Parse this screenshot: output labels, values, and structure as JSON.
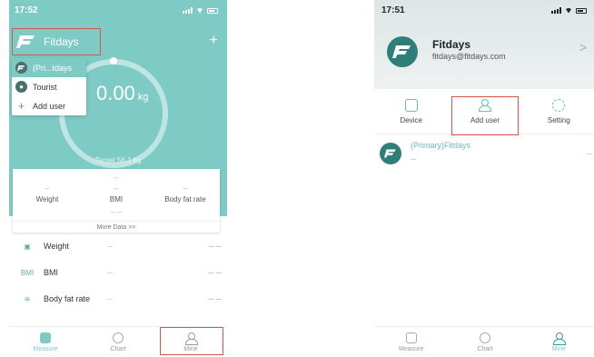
{
  "left": {
    "status_time": "17:52",
    "app_title": "Fitdays",
    "add_icon": "plus-icon",
    "weight_value": "0.00",
    "weight_unit": "kg",
    "dropdown": [
      {
        "label": "(Pri...tdays",
        "icon": "fitdays-logo-icon",
        "active": true
      },
      {
        "label": "Tourist",
        "icon": "user-icon",
        "active": false
      },
      {
        "label": "Add user",
        "icon": "plus-icon",
        "active": false
      }
    ],
    "target": "Target:56.1 kg",
    "card": {
      "top_value": "--",
      "weight_value": "--",
      "bmi_value": "--",
      "fat_value": "--",
      "labels": [
        "Weight",
        "BMI",
        "Body fat rate"
      ],
      "bottom_value": "-- --",
      "more_label": "More Data >>"
    },
    "metrics": [
      {
        "icon": "scale-icon",
        "label": "Weight",
        "mid": "--",
        "value": "-- --"
      },
      {
        "icon": "bmi-icon",
        "icon_text": "BMI",
        "label": "BMI",
        "mid": "--",
        "value": "-- --"
      },
      {
        "icon": "body-fat-icon",
        "label": "Body fat rate",
        "mid": "--",
        "value": "-- --"
      }
    ],
    "tabs": [
      {
        "label": "Measure",
        "icon": "measure-icon",
        "active": true
      },
      {
        "label": "Chart",
        "icon": "chart-icon",
        "active": false
      },
      {
        "label": "Mine",
        "icon": "person-icon",
        "active": false
      }
    ]
  },
  "right": {
    "status_time": "17:51",
    "profile_name": "Fitdays",
    "profile_email": "fitdays@fitdays.com",
    "chevron": ">",
    "actions": [
      {
        "label": "Device",
        "icon": "device-icon"
      },
      {
        "label": "Add  user",
        "icon": "add-user-icon"
      },
      {
        "label": "Setting",
        "icon": "gear-icon"
      }
    ],
    "user": {
      "name": "(Primary)Fitdays",
      "sub": "--",
      "right": "--"
    },
    "tabs": [
      {
        "label": "Measure",
        "icon": "measure-icon",
        "active": false
      },
      {
        "label": "Chart",
        "icon": "chart-icon",
        "active": false
      },
      {
        "label": "Mine",
        "icon": "person-icon",
        "active": true
      }
    ]
  },
  "colors": {
    "teal": "#7ecbc6",
    "dark_teal": "#2e7f7a",
    "highlight": "#d9534f"
  }
}
